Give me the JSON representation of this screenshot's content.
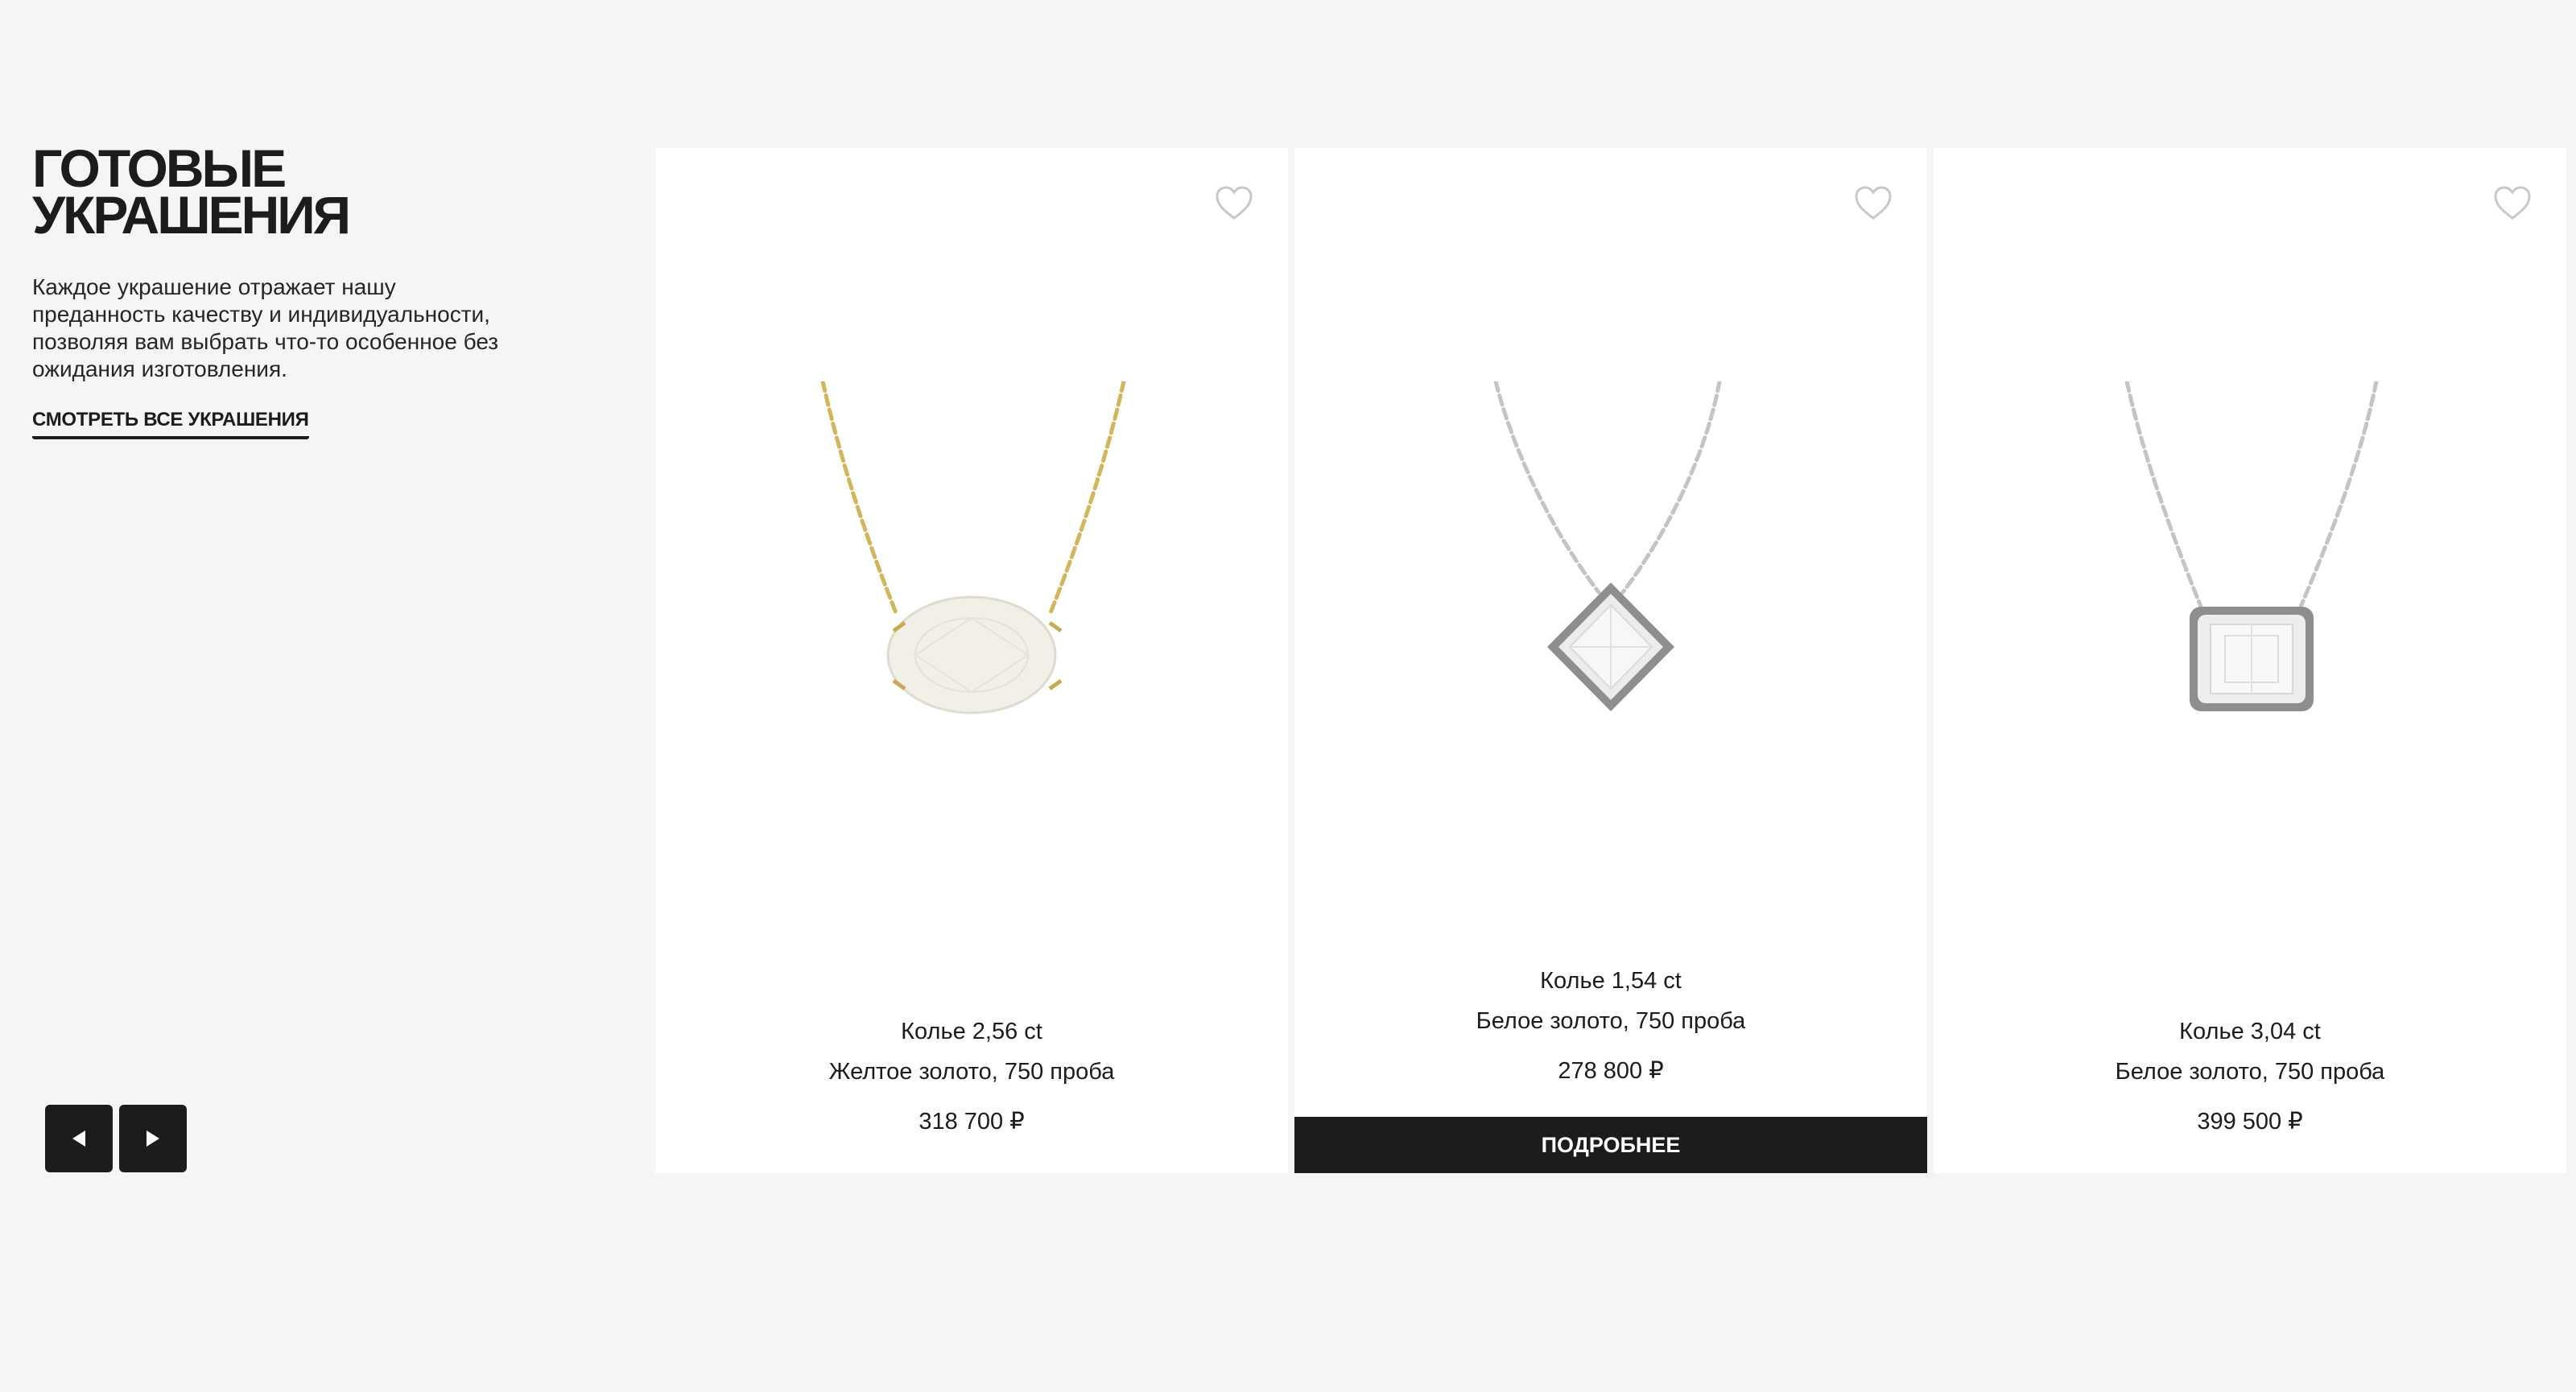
{
  "section": {
    "title_line1": "ГОТОВЫЕ",
    "title_line2": "УКРАШЕНИЯ",
    "description": "Каждое украшение отражает нашу преданность качеству и индивидуальности, позволяя вам выбрать что-то особенное без ожидания изготовления.",
    "view_all_label": "СМОТРЕТЬ ВСЕ УКРАШЕНИЯ"
  },
  "navigation": {
    "prev_icon": "triangle-left-icon",
    "next_icon": "triangle-right-icon"
  },
  "products": [
    {
      "name": "Колье 2,56 ct",
      "metal": "Желтое золото, 750 проба",
      "price": "318 700 ₽",
      "metal_color": "#d8bf6a",
      "stone_shape": "oval",
      "favorite_icon": "heart-outline-icon"
    },
    {
      "name": "Колье 1,54 ct",
      "metal": "Белое золото, 750 проба",
      "price": "278 800 ₽",
      "metal_color": "#bfbfbf",
      "stone_shape": "princess",
      "favorite_icon": "heart-outline-icon",
      "details_label": "ПОДРОБНЕЕ"
    },
    {
      "name": "Колье 3,04 ct",
      "metal": "Белое золото, 750 проба",
      "price": "399 500 ₽",
      "metal_color": "#bfbfbf",
      "stone_shape": "emerald",
      "favorite_icon": "heart-outline-icon"
    }
  ],
  "colors": {
    "background": "#f5f5f5",
    "card": "#ffffff",
    "dark": "#1c1c1c"
  }
}
